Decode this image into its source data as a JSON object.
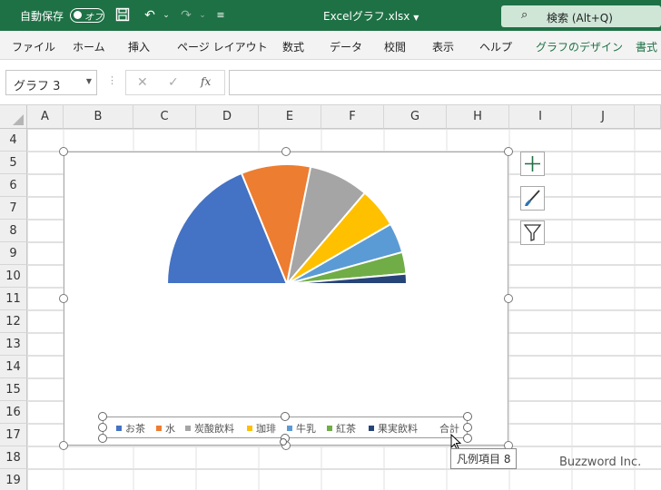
{
  "titlebar": {
    "autosave_label": "自動保存",
    "autosave_state": "オフ",
    "filename": "Excelグラフ.xlsx",
    "search_label": "検索 (Alt+Q)"
  },
  "ribbon": {
    "tabs": [
      "ファイル",
      "ホーム",
      "挿入",
      "ページ レイアウト",
      "数式",
      "データ",
      "校閲",
      "表示",
      "ヘルプ",
      "グラフのデザイン",
      "書式"
    ]
  },
  "formula_bar": {
    "name_box": "グラフ 3",
    "formula": ""
  },
  "columns": [
    "A",
    "B",
    "C",
    "D",
    "E",
    "F",
    "G",
    "H",
    "I",
    "J"
  ],
  "rows": [
    "4",
    "5",
    "6",
    "7",
    "8",
    "9",
    "10",
    "11",
    "12",
    "13",
    "14",
    "15",
    "16",
    "17",
    "18",
    "19"
  ],
  "chart": {
    "legend_items": [
      {
        "label": "お茶",
        "color": "#4472c4"
      },
      {
        "label": "水",
        "color": "#ed7d31"
      },
      {
        "label": "炭酸飲料",
        "color": "#a5a5a5"
      },
      {
        "label": "珈琲",
        "color": "#ffc000"
      },
      {
        "label": "牛乳",
        "color": "#5b9bd5"
      },
      {
        "label": "紅茶",
        "color": "#70ad47"
      },
      {
        "label": "果実飲料",
        "color": "#264478"
      },
      {
        "label": "合計",
        "color": ""
      }
    ]
  },
  "chart_data": {
    "type": "pie",
    "categories": [
      "お茶",
      "水",
      "炭酸飲料",
      "珈琲",
      "牛乳",
      "紅茶",
      "果実飲料",
      "合計"
    ],
    "values": [
      21.9,
      10.9,
      9.4,
      6.3,
      4.7,
      3.4,
      1.6,
      58.2
    ],
    "colors": [
      "#4472c4",
      "#ed7d31",
      "#a5a5a5",
      "#ffc000",
      "#5b9bd5",
      "#70ad47",
      "#264478",
      "none"
    ],
    "legend_position": "bottom"
  },
  "tooltip": "凡例項目 8",
  "watermark": "Buzzword Inc."
}
